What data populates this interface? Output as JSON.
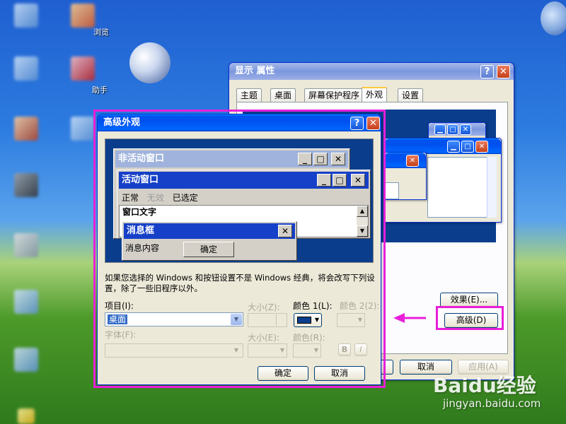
{
  "desktop": {
    "icon_labels": [
      "浏览",
      "助手"
    ]
  },
  "display_props": {
    "title": "显示 属性",
    "help_btn": "?",
    "close_btn": "✕",
    "tabs": [
      "主题",
      "桌面",
      "屏幕保护程序",
      "外观",
      "设置"
    ],
    "active_tab": "外观",
    "effects_btn": "效果(E)...",
    "advanced_btn": "高级(D)",
    "cancel_btn": "取消",
    "apply_btn": "应用(A)"
  },
  "advanced": {
    "title": "高级外观",
    "help_btn": "?",
    "close_btn": "✕",
    "preview": {
      "inactive_title": "非活动窗口",
      "active_title": "活动窗口",
      "menu": [
        "正常",
        "无效",
        "已选定"
      ],
      "window_text": "窗口文字",
      "msgbox_title": "消息框",
      "msgbox_text": "消息内容",
      "msgbox_ok": "确定"
    },
    "note": "如果您选择的 Windows 和按钮设置不是 Windows 经典，将会改写下列设置，除了一些旧程序以外。",
    "item_label": "项目(I):",
    "item_value": "桌面",
    "size_label": "大小(Z):",
    "color1_label": "颜色 1(L):",
    "color2_label": "颜色 2(2):",
    "font_label": "字体(F):",
    "size2_label": "大小(E):",
    "color_label": "颜色(R):",
    "bold_btn": "B",
    "italic_btn": "I",
    "ok_btn": "确定",
    "cancel_btn": "取消"
  },
  "colors": {
    "highlight": "#e81fd8",
    "xp_blue": "#0053ee",
    "classic_active": "#1640c8",
    "classic_inactive": "#9fb3dc",
    "desktop_preview": "#0a3e8c"
  },
  "watermark": {
    "brand": "Baidu经验",
    "url": "jingyan.baidu.com"
  }
}
